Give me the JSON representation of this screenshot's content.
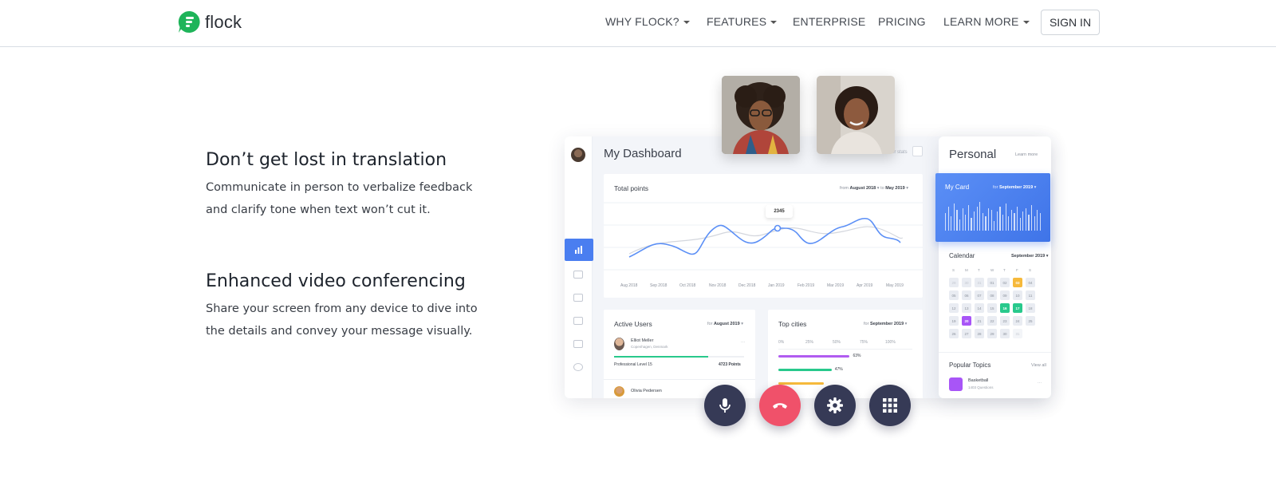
{
  "brand": {
    "name": "flock",
    "color": "#1fb45a"
  },
  "nav": {
    "items": [
      {
        "label": "WHY FLOCK?",
        "dropdown": true
      },
      {
        "label": "FEATURES",
        "dropdown": true
      },
      {
        "label": "ENTERPRISE",
        "dropdown": false
      },
      {
        "label": "PRICING",
        "dropdown": false
      },
      {
        "label": "LEARN MORE",
        "dropdown": true
      }
    ],
    "signin_label": "SIGN IN"
  },
  "features": [
    {
      "title": "Don’t get lost in translation",
      "body_line1": "Communicate in person to verbalize feedback",
      "body_line2": "and clarify tone when text won’t cut it."
    },
    {
      "title": "Enhanced video conferencing",
      "body_line1": "Share your screen from any device to dive into",
      "body_line2": "the details and convey your message visually."
    }
  ],
  "dashboard": {
    "title": "My Dashboard",
    "filter_label": "Filter stats",
    "total_points": {
      "title": "Total points",
      "from_label": "from",
      "from_value": "August 2018",
      "to_label": "to",
      "to_value": "May 2019",
      "tooltip": "2345",
      "months": [
        "Aug 2018",
        "Sep 2018",
        "Oct 2018",
        "Nov 2018",
        "Dec 2018",
        "Jan 2019",
        "Feb 2019",
        "Mar 2019",
        "Apr 2019",
        "May 2019"
      ]
    },
    "active_users": {
      "title": "Active Users",
      "for_label": "for",
      "for_value": "August 2019",
      "user1_name": "Elliot Meller",
      "user1_location": "Copenhagen, Denmark",
      "user1_level": "Professional Level 15",
      "user1_points": "4723 Points",
      "user2_name": "Olivia Pedersen"
    },
    "top_cities": {
      "title": "Top cities",
      "for_label": "for",
      "for_value": "September 2019",
      "scale": [
        "0%",
        "25%",
        "50%",
        "75%",
        "100%"
      ],
      "bars": [
        {
          "value": 63,
          "label": "63%",
          "color": "#b15cf0"
        },
        {
          "value": 47,
          "label": "47%",
          "color": "#28c98c"
        },
        {
          "value": 40,
          "label": "",
          "color": "#f6b93b"
        }
      ]
    }
  },
  "personal": {
    "title": "Personal",
    "learn_more": "Learn more",
    "my_card": {
      "title": "My Card",
      "for_label": "for",
      "for_value": "September 2019"
    },
    "calendar": {
      "title": "Calendar",
      "month": "September 2019",
      "weekdays": [
        "S",
        "M",
        "T",
        "W",
        "T",
        "F",
        "S"
      ],
      "days": [
        "29",
        "30",
        "31",
        "01",
        "02",
        "03",
        "04",
        "05",
        "06",
        "07",
        "08",
        "09",
        "10",
        "11",
        "12",
        "13",
        "14",
        "15",
        "16",
        "17",
        "18",
        "19",
        "20",
        "21",
        "22",
        "23",
        "24",
        "25",
        "26",
        "27",
        "28",
        "29",
        "30",
        "31"
      ]
    },
    "popular_topics": {
      "title": "Popular Topics",
      "view_all": "View all",
      "topic_name": "Basketball",
      "topic_sub": "1403 Questions"
    }
  },
  "controls": [
    {
      "name": "microphone",
      "color": "#363a56"
    },
    {
      "name": "hang-up",
      "color": "#f0516a"
    },
    {
      "name": "settings",
      "color": "#363a56"
    },
    {
      "name": "keypad",
      "color": "#363a56"
    }
  ]
}
